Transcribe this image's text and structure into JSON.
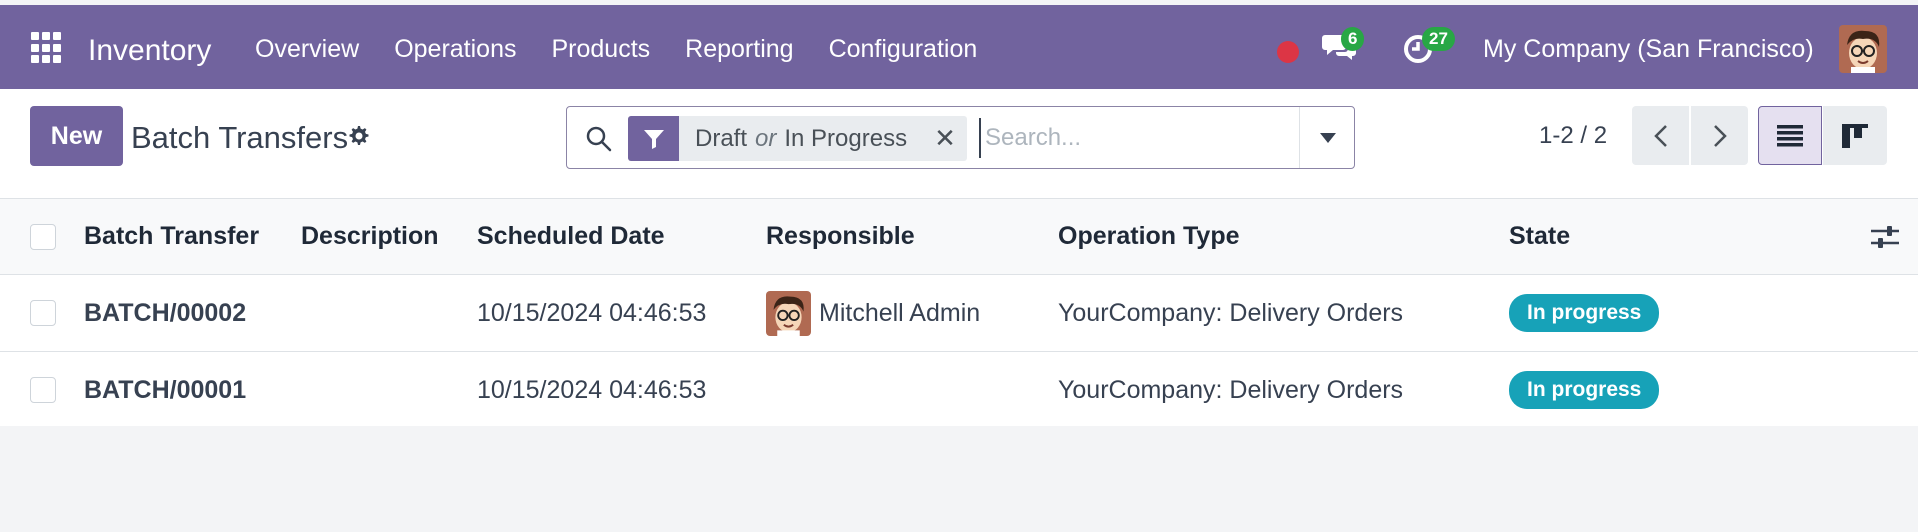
{
  "navbar": {
    "app_name": "Inventory",
    "menu": [
      "Overview",
      "Operations",
      "Products",
      "Reporting",
      "Configuration"
    ],
    "chat_count": "6",
    "activity_count": "27",
    "company": "My Company (San Francisco)",
    "bg_color": "#71639e"
  },
  "control_panel": {
    "new_label": "New",
    "title": "Batch Transfers",
    "facet": {
      "value_1": "Draft",
      "separator": "or",
      "value_2": "In Progress"
    },
    "search_placeholder": "Search...",
    "pager": "1-2 / 2"
  },
  "table": {
    "headers": {
      "batch_transfer": "Batch Transfer",
      "description": "Description",
      "scheduled_date": "Scheduled Date",
      "responsible": "Responsible",
      "operation_type": "Operation Type",
      "state": "State"
    },
    "rows": [
      {
        "batch_transfer": "BATCH/00002",
        "description": "",
        "scheduled_date": "10/15/2024 04:46:53",
        "responsible": "Mitchell Admin",
        "operation_type": "YourCompany: Delivery Orders",
        "state": "In progress"
      },
      {
        "batch_transfer": "BATCH/00001",
        "description": "",
        "scheduled_date": "10/15/2024 04:46:53",
        "responsible": "",
        "operation_type": "YourCompany: Delivery Orders",
        "state": "In progress"
      }
    ]
  },
  "colors": {
    "primary": "#71639e",
    "state_badge": "#17a2b8",
    "badge_green": "#28a745",
    "record_dot": "#dc3545"
  }
}
